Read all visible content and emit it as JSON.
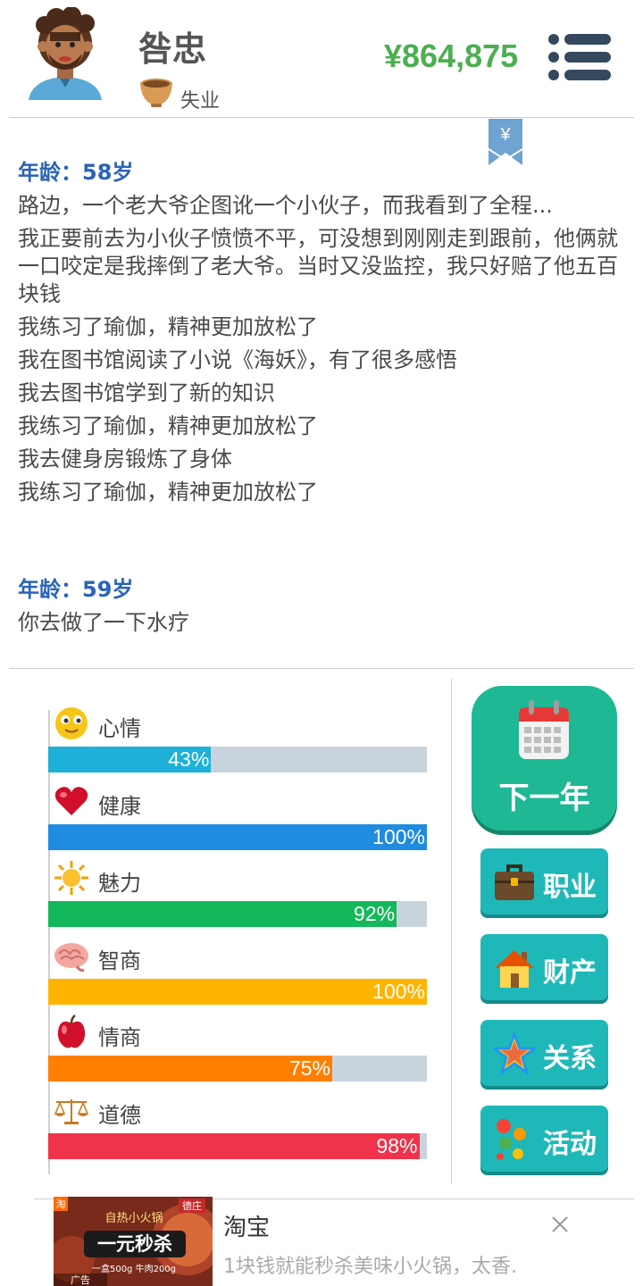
{
  "header": {
    "name": "咎忠",
    "job": "失业",
    "money": "¥864,875"
  },
  "log": {
    "age1": "年龄：58岁",
    "lines1": [
      "路边，一个老大爷企图讹一个小伙子，而我看到了全程...",
      "我正要前去为小伙子愤愤不平，可没想到刚刚走到跟前，他俩就一口咬定是我摔倒了老大爷。当时又没监控，我只好赔了他五百块钱",
      "我练习了瑜伽，精神更加放松了",
      "我在图书馆阅读了小说《海妖》，有了很多感悟",
      "我去图书馆学到了新的知识",
      "我练习了瑜伽，精神更加放松了",
      "我去健身房锻炼了身体",
      "我练习了瑜伽，精神更加放松了"
    ],
    "age2": "年龄：59岁",
    "lines2": [
      "你去做了一下水疗"
    ]
  },
  "stats": [
    {
      "label": "心情",
      "value": 43,
      "pct": "43%",
      "color": "#1eb0d8",
      "icon": "smiley-icon"
    },
    {
      "label": "健康",
      "value": 100,
      "pct": "100%",
      "color": "#1f8ce0",
      "icon": "heart-icon"
    },
    {
      "label": "魅力",
      "value": 92,
      "pct": "92%",
      "color": "#13b85a",
      "icon": "sun-icon"
    },
    {
      "label": "智商",
      "value": 100,
      "pct": "100%",
      "color": "#ffb400",
      "icon": "brain-icon"
    },
    {
      "label": "情商",
      "value": 75,
      "pct": "75%",
      "color": "#ff7f00",
      "icon": "apple-icon"
    },
    {
      "label": "道德",
      "value": 98,
      "pct": "98%",
      "color": "#f0334a",
      "icon": "scale-icon"
    }
  ],
  "buttons": {
    "next_year": "下一年",
    "career": "职业",
    "property": "财产",
    "relations": "关系",
    "activities": "活动"
  },
  "ad": {
    "title": "淘宝",
    "desc": "1块钱就能秒杀美味小火锅，太香.",
    "badge": "广告",
    "img_tag": "淘",
    "img_brand": "德庄",
    "img_line1": "自热小火锅",
    "img_line2": "一元秒杀",
    "img_line3": "一盒500g 牛肉200g"
  }
}
